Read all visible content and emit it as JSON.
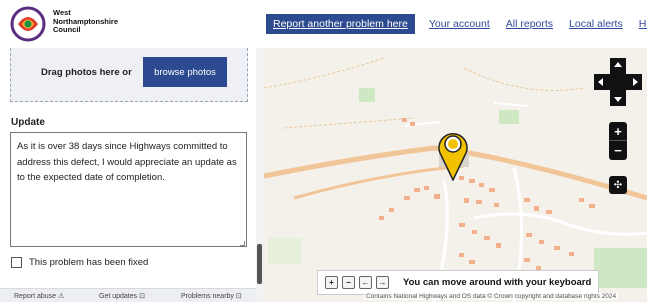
{
  "brand": {
    "name_lines": [
      "West",
      "Northamptonshire",
      "Council"
    ],
    "logo": "council-logo"
  },
  "nav": {
    "report_another": "Report another problem here",
    "your_account": "Your account",
    "all_reports": "All reports",
    "local_alerts": "Local alerts",
    "help": "Help"
  },
  "photos": {
    "drag_text": "Drag photos here or",
    "browse_label": "browse photos"
  },
  "update": {
    "label": "Update",
    "value": "As it is over 38 days since Highways committed to address this defect, I would appreciate an update as to the expected date of completion."
  },
  "fixed": {
    "label": "This problem has been fixed",
    "checked": false
  },
  "footer": {
    "report_abuse": "Report abuse",
    "get_updates": "Get updates",
    "problems_nearby": "Problems nearby"
  },
  "map": {
    "keyboard_hint": "You can move around with your keyboard",
    "keys": [
      "+",
      "−",
      "←",
      "→"
    ],
    "attribution": "Contains National Highways and OS data © Crown copyright and database rights 2024",
    "zoom_in": "+",
    "zoom_out": "−",
    "layers_icon": "layers-icon",
    "pin_color": "#f2c200"
  },
  "colors": {
    "brand_blue": "#2b4a8f",
    "link": "#2f4a9a",
    "road": "#f5c99a",
    "building": "#f2b08c",
    "park": "#cfe8c4"
  }
}
